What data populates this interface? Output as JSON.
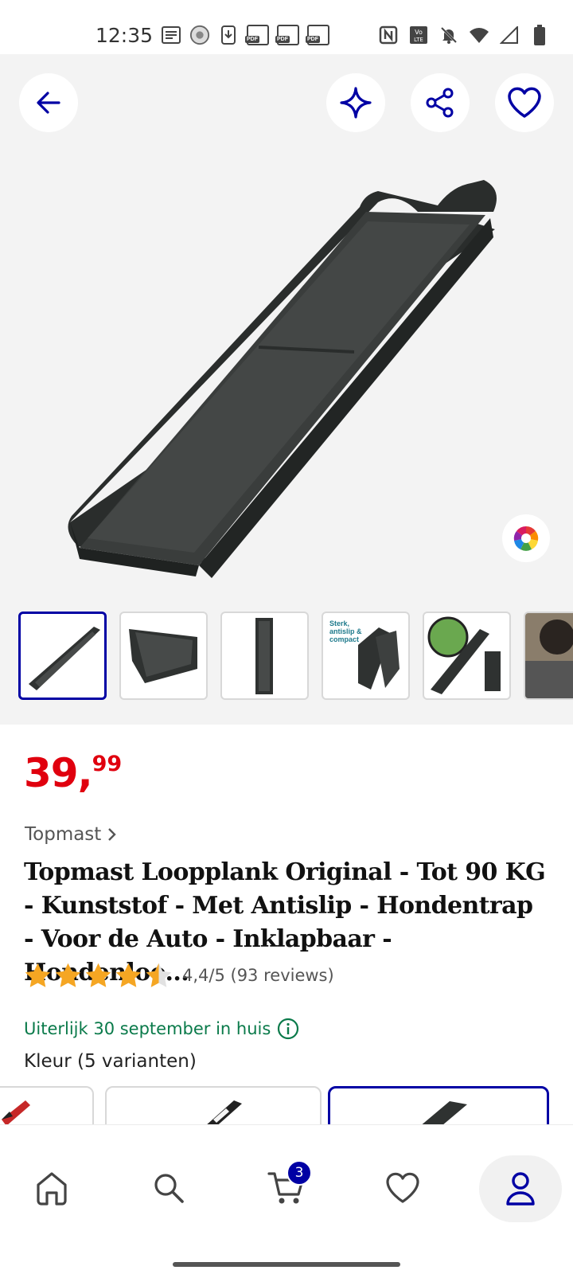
{
  "status_bar": {
    "time": "12:35",
    "pdf_label": "PDF"
  },
  "hero": {
    "thumbnail_caption": "Sterk, antislip & compact"
  },
  "product": {
    "price_int": "39,",
    "price_dec": "99",
    "brand": "Topmast",
    "title": "Topmast Loopplank Original - Tot 90 KG - Kunststof - Met Antislip - Hondentrap - Voor de Auto - Inklapbaar - Hondenloo...",
    "rating_value": 4.4,
    "rating_text": "4,4/5 (93 reviews)",
    "delivery": "Uiterlijk 30 september in huis",
    "color_label": "Kleur (5 varianten)"
  },
  "bottom_nav": {
    "cart_count": "3",
    "items": [
      "home-icon",
      "search-icon",
      "cart-icon",
      "heart-icon",
      "account-icon"
    ]
  },
  "colors": {
    "brand_blue": "#0000a4",
    "price_red": "#e0000e",
    "delivery_green": "#0a7a4a",
    "star": "#f5a623"
  }
}
